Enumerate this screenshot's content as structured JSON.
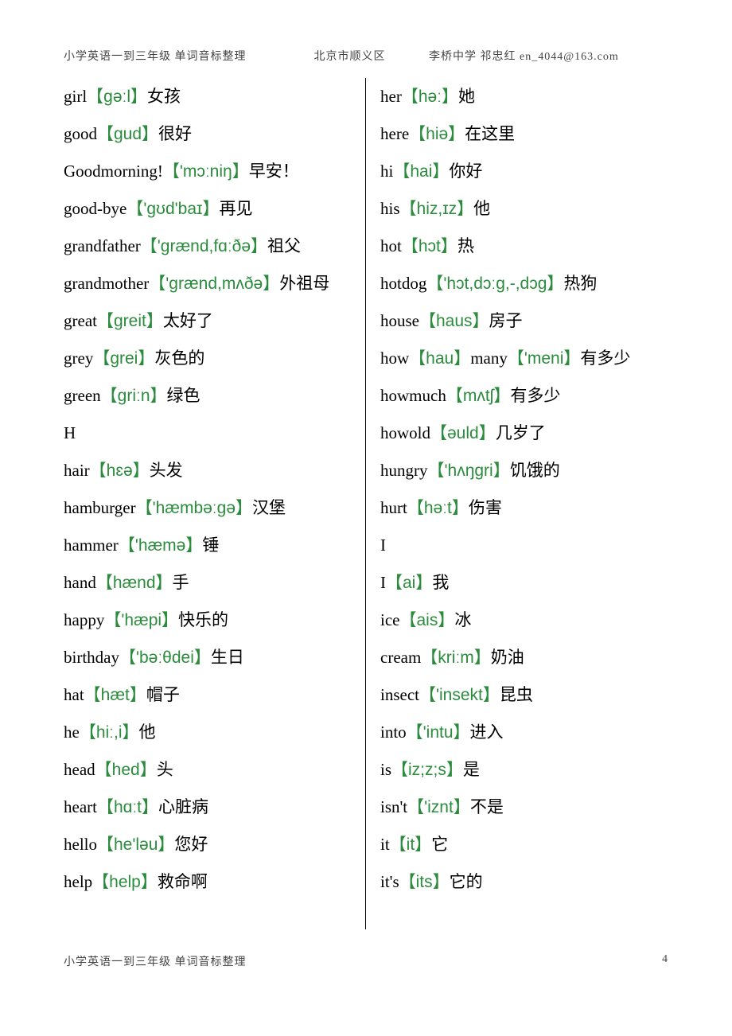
{
  "header": {
    "title_left": "小学英语一到三年级  单词音标整理",
    "title_mid": "北京市顺义区",
    "title_right": "李桥中学  祁忠红  en_4044@163.com"
  },
  "footer": {
    "text": "小学英语一到三年级  单词音标整理",
    "page": "4"
  },
  "left_entries": [
    {
      "word": "girl",
      "phon": "ɡəːl",
      "cn": "女孩"
    },
    {
      "word": "good",
      "phon": "ɡud",
      "cn": "很好"
    },
    {
      "word": "Goodmorning!",
      "phon": "'mɔːniŋ",
      "cn": "早安！"
    },
    {
      "word": "good-bye",
      "phon": "'ɡʊd'baɪ",
      "cn": "再见"
    },
    {
      "word": "grandfather",
      "phon": "'ɡrænd,fɑːðə",
      "cn": "祖父"
    },
    {
      "word": "grandmother",
      "phon": "'ɡrænd,mʌðə",
      "cn": "外祖母"
    },
    {
      "word": "great",
      "phon": "ɡreit",
      "cn": "太好了"
    },
    {
      "word": "grey",
      "phon": "ɡrei",
      "cn": "灰色的"
    },
    {
      "word": "green",
      "phon": "ɡriːn",
      "cn": "绿色"
    },
    {
      "section": "H"
    },
    {
      "word": "hair",
      "phon": "hɛə",
      "cn": "头发"
    },
    {
      "word": "hamburger",
      "phon": "'hæmbəːɡə",
      "cn": "汉堡"
    },
    {
      "word": "hammer",
      "phon": "'hæmə",
      "cn": "锤"
    },
    {
      "word": "hand",
      "phon": "hænd",
      "cn": "手"
    },
    {
      "word": "happy",
      "phon": "'hæpi",
      "cn": "快乐的"
    },
    {
      "word": "birthday",
      "phon": "'bəːθdei",
      "cn": "生日"
    },
    {
      "word": "hat",
      "phon": "hæt",
      "cn": "帽子"
    },
    {
      "word": "he",
      "phon": "hiː,i",
      "cn": "他"
    },
    {
      "word": "head",
      "phon": "hed",
      "cn": "头"
    },
    {
      "word": "heart",
      "phon": "hɑːt",
      "cn": "心脏病"
    },
    {
      "word": "hello",
      "phon": "he'ləu",
      "cn": "您好"
    },
    {
      "word": "help",
      "phon": "help",
      "cn": "救命啊"
    }
  ],
  "right_entries": [
    {
      "word": "her",
      "phon": "həː",
      "cn": "她"
    },
    {
      "word": "here",
      "phon": "hiə",
      "cn": "在这里"
    },
    {
      "word": "hi",
      "phon": "hai",
      "cn": "你好"
    },
    {
      "word": "his",
      "phon": "hiz,ɪz",
      "cn": "他"
    },
    {
      "word": "hot",
      "phon": "hɔt",
      "cn": "热"
    },
    {
      "word": "hotdog",
      "phon": "'hɔt,dɔːɡ,-,dɔɡ",
      "cn": "热狗"
    },
    {
      "word": "house",
      "phon": "haus",
      "cn": "房子"
    },
    {
      "word": "how",
      "phon": "hau",
      "cn_mid": "many",
      "phon2": "'meni",
      "cn": "有多少"
    },
    {
      "word": "howmuch",
      "phon": "mʌtʃ",
      "cn": "有多少"
    },
    {
      "word": "howold",
      "phon": "əuld",
      "cn": "几岁了"
    },
    {
      "word": "hungry",
      "phon": "'hʌŋɡri",
      "cn": "饥饿的"
    },
    {
      "word": "hurt",
      "phon": "həːt",
      "cn": "伤害"
    },
    {
      "section": "I"
    },
    {
      "word": "I",
      "phon": "ai",
      "cn": "我"
    },
    {
      "word": "ice",
      "phon": "ais",
      "cn": "冰"
    },
    {
      "word": "cream",
      "phon": "kriːm",
      "cn": "奶油"
    },
    {
      "word": "insect",
      "phon": "'insekt",
      "cn": "昆虫"
    },
    {
      "word": "into",
      "phon": "'intu",
      "cn": "进入"
    },
    {
      "word": "is",
      "phon": "iz;z;s",
      "cn": "是"
    },
    {
      "word": "isn't",
      "phon": "'iznt",
      "cn": "不是"
    },
    {
      "word": "it",
      "phon": "it",
      "cn": "它"
    },
    {
      "word": "it's",
      "phon": "its",
      "cn": "它的"
    }
  ]
}
